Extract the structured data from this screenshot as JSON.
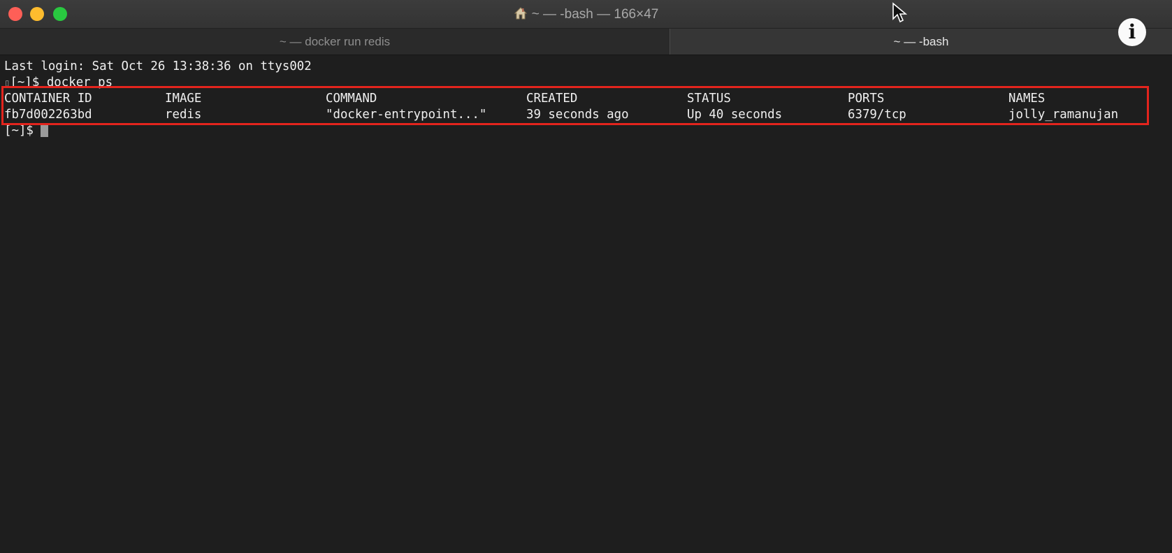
{
  "window": {
    "title": "~ — -bash — 166×47",
    "traffic_lights": [
      "close",
      "minimize",
      "maximize"
    ]
  },
  "tabs": [
    {
      "label": "~ — docker run redis",
      "active": false
    },
    {
      "label": "~ — -bash",
      "active": true
    }
  ],
  "terminal": {
    "last_login": "Last login: Sat Oct 26 13:38:36 on ttys002",
    "prompt": "[~]$",
    "command": "docker ps",
    "table_headers": [
      "CONTAINER ID",
      "IMAGE",
      "COMMAND",
      "CREATED",
      "STATUS",
      "PORTS",
      "NAMES"
    ],
    "table_rows": [
      [
        "fb7d002263bd",
        "redis",
        "\"docker-entrypoint...\"",
        "39 seconds ago",
        "Up 40 seconds",
        "6379/tcp",
        "jolly_ramanujan"
      ]
    ]
  },
  "icons": {
    "home": "home-icon",
    "info": "info-icon",
    "cursor": "mouse-pointer-icon",
    "info_glyph": "i"
  },
  "colors": {
    "background": "#1e1e1e",
    "highlight_border": "#e3241d",
    "text": "#f0f0f0"
  }
}
